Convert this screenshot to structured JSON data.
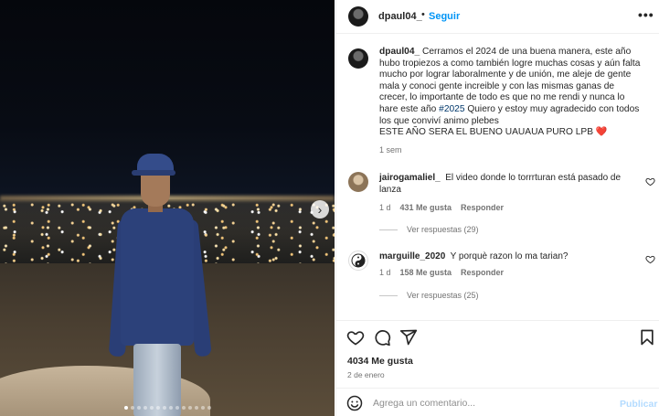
{
  "post": {
    "username": "dpaul04_",
    "separator": "•",
    "follow_label": "Seguir",
    "more_icon": "more-horizontal-icon",
    "photo": {
      "carousel_next_icon": "chevron-right-icon",
      "slide_count": 14,
      "active_slide": 1
    }
  },
  "caption": {
    "username": "dpaul04_",
    "text_before_tag": "Cerramos el 2024 de una buena manera, este año hubo tropiezos a como también logre muchas cosas y aún falta mucho por lograr laboralmente y de unión, me aleje de gente mala y conoci gente increible y con las mismas ganas de crecer, lo importante de todo es que no me rendi y nunca lo hare este año",
    "hashtag": "#2025",
    "text_after_tag": "Quiero y estoy muy agradecido con todos los que conviví animo plebes",
    "line2": "ESTE AÑO SERA EL BUENO UAUAUA PURO LPB",
    "heart": "❤️",
    "time": "1 sem"
  },
  "comments": [
    {
      "username": "jairogamaliel_",
      "text": "El video donde lo torrrturan está pasado de lanza",
      "time": "1 d",
      "likes": "431 Me gusta",
      "reply_label": "Responder",
      "view_replies": "Ver respuestas (29)"
    },
    {
      "username": "marguille_2020",
      "text": "Y porquè razon lo ma tarian?",
      "time": "1 d",
      "likes": "158 Me gusta",
      "reply_label": "Responder",
      "view_replies": "Ver respuestas (25)"
    }
  ],
  "actions": {
    "likes": "4034 Me gusta",
    "date": "2 de enero"
  },
  "composer": {
    "placeholder": "Agrega un comentario...",
    "post_label": "Publicar"
  },
  "colors": {
    "accent": "#0095f6",
    "hashtag": "#00376b",
    "muted": "#737373",
    "post_disabled": "#b3dbff"
  }
}
